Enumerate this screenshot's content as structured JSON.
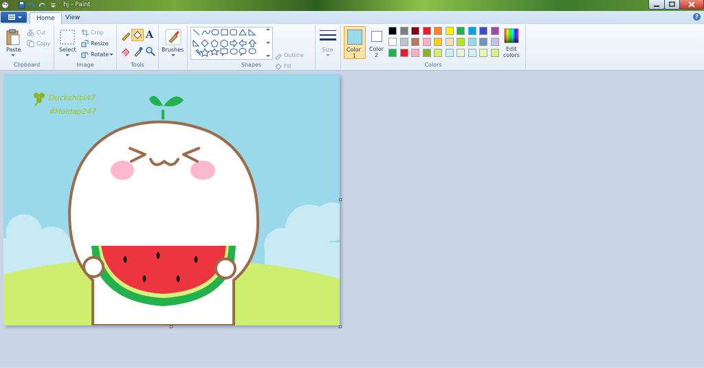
{
  "window": {
    "title": "hj - Paint"
  },
  "tabs": [
    {
      "label": "Home"
    },
    {
      "label": "View"
    }
  ],
  "help_label": "?",
  "clipboard": {
    "paste": "Paste",
    "cut": "Cut",
    "copy": "Copy",
    "group": "Clipboard"
  },
  "image": {
    "select": "Select",
    "crop": "Crop",
    "resize": "Resize",
    "rotate": "Rotate",
    "group": "Image"
  },
  "tools": {
    "group": "Tools",
    "text_tool": "A"
  },
  "brushes": {
    "label": "Brushes"
  },
  "shapes": {
    "outline": "Outline",
    "fill": "Fill",
    "group": "Shapes"
  },
  "size": {
    "label": "Size"
  },
  "colors": {
    "color1_label": "Color",
    "color1_index": "1",
    "color2_label": "Color",
    "color2_index": "2",
    "edit_label": "Edit",
    "edit_label2": "colors",
    "group": "Colors",
    "color1": "#99d9ea",
    "color2": "#ffffff",
    "palette_row1": [
      "#000000",
      "#7f7f7f",
      "#880015",
      "#ed1c24",
      "#ff7f27",
      "#fff200",
      "#22b14c",
      "#00a2e8",
      "#3f48cc",
      "#a349a4"
    ],
    "palette_row2": [
      "#ffffff",
      "#c3c3c3",
      "#b97a57",
      "#ffaec9",
      "#ffc90e",
      "#efe4b0",
      "#b5e61d",
      "#99d9ea",
      "#7092be",
      "#c8bfe7"
    ],
    "palette_row3": [
      "#22b14c",
      "#ed1c24",
      "#ffaec9",
      "#8fb31d",
      "#d9ea6c",
      "#c8eef2",
      "#e8f5d9",
      "#d0f0f5",
      "#e8f7a8",
      "#d9f07a"
    ]
  },
  "canvas_art": {
    "watermark_line1": "Duckchibi47",
    "watermark_line2": "#Hoidap247",
    "sky": "#99d9ea",
    "grass": "#cdee6e",
    "outline": "#9c6b4a"
  }
}
